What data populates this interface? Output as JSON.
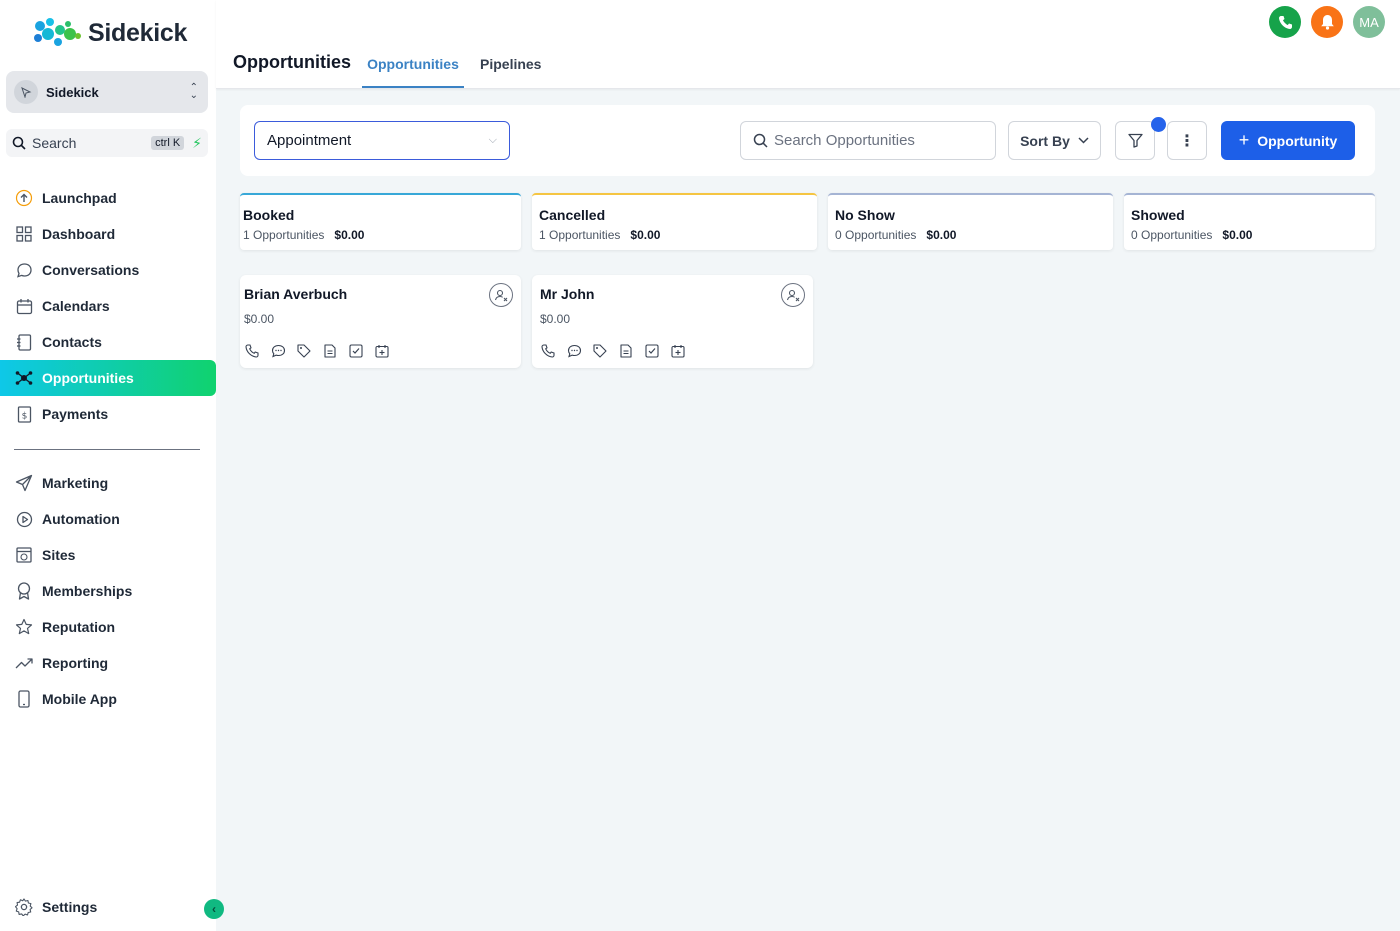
{
  "app": {
    "brand": "Sidekick",
    "account_name": "Sidekick",
    "search_label": "Search",
    "search_shortcut": "ctrl K"
  },
  "sidebar": {
    "primary": [
      {
        "label": "Launchpad",
        "icon": "launchpad-icon"
      },
      {
        "label": "Dashboard",
        "icon": "dashboard-icon"
      },
      {
        "label": "Conversations",
        "icon": "chat-bubble-icon"
      },
      {
        "label": "Calendars",
        "icon": "calendar-icon"
      },
      {
        "label": "Contacts",
        "icon": "contacts-book-icon"
      },
      {
        "label": "Opportunities",
        "icon": "opportunities-icon",
        "active": true
      },
      {
        "label": "Payments",
        "icon": "payments-icon"
      }
    ],
    "secondary": [
      {
        "label": "Marketing",
        "icon": "paper-plane-icon"
      },
      {
        "label": "Automation",
        "icon": "automation-icon"
      },
      {
        "label": "Sites",
        "icon": "sites-icon"
      },
      {
        "label": "Memberships",
        "icon": "badge-icon"
      },
      {
        "label": "Reputation",
        "icon": "star-icon"
      },
      {
        "label": "Reporting",
        "icon": "trend-icon"
      },
      {
        "label": "Mobile App",
        "icon": "mobile-icon"
      }
    ],
    "settings_label": "Settings"
  },
  "header": {
    "title": "Opportunities",
    "tabs": [
      {
        "label": "Opportunities",
        "active": true
      },
      {
        "label": "Pipelines",
        "active": false
      }
    ],
    "user_initials": "MA"
  },
  "toolbar": {
    "pipeline_value": "Appointment",
    "search_placeholder": "Search Opportunities",
    "sort_label": "Sort By",
    "add_label": "Opportunity"
  },
  "board": {
    "stages": [
      {
        "name": "Booked",
        "count": "1 Opportunities",
        "amount": "$0.00",
        "color": "#38a8d8"
      },
      {
        "name": "Cancelled",
        "count": "1 Opportunities",
        "amount": "$0.00",
        "color": "#f5c542"
      },
      {
        "name": "No Show",
        "count": "0 Opportunities",
        "amount": "$0.00",
        "color": "#a5b4d4"
      },
      {
        "name": "Showed",
        "count": "0 Opportunities",
        "amount": "$0.00",
        "color": "#a5b4d4"
      }
    ],
    "cards": [
      {
        "name": "Brian Averbuch",
        "amount": "$0.00"
      },
      {
        "name": "Mr John",
        "amount": "$0.00"
      }
    ]
  },
  "colors": {
    "accent": "#1d5fe8",
    "active_nav_start": "#0ec8e8",
    "active_nav_end": "#10d26e",
    "tab_active": "#3b82c4"
  }
}
